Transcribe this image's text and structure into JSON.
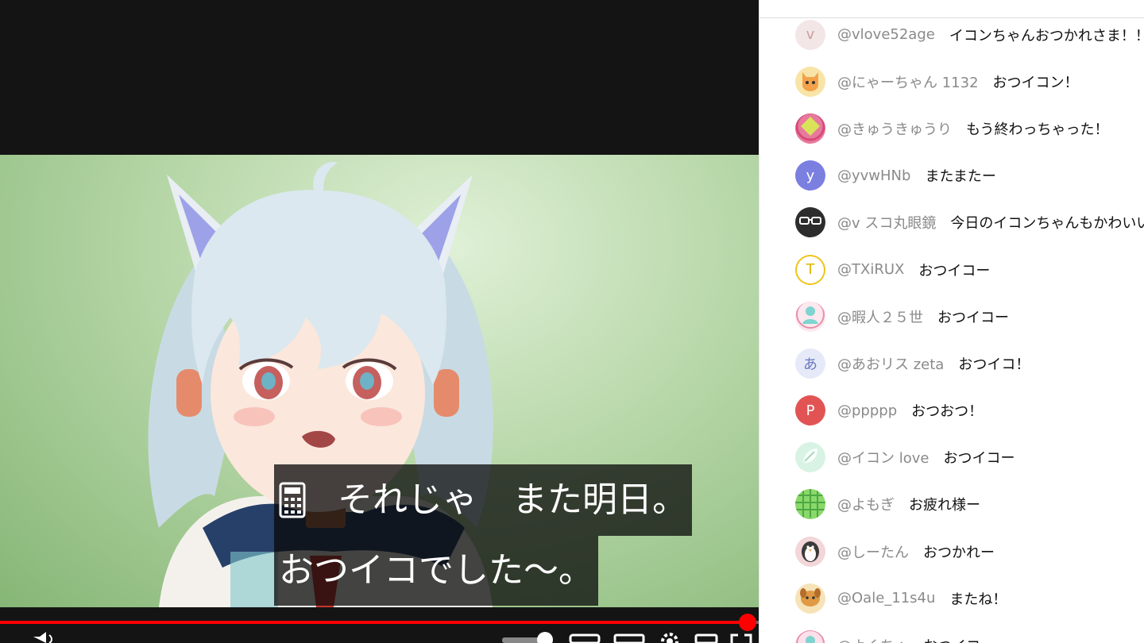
{
  "video": {
    "captions": {
      "line1": "それじゃ　また明日。",
      "line2": "おつイコでした～。"
    },
    "progress": 0.985,
    "colors": {
      "progress": "#ff0000",
      "letterbox": "#141414"
    }
  },
  "chat": {
    "messages": [
      {
        "author": "@vlove52age",
        "text": "イコンちゃんおつかれさま！！",
        "avatar_letter": "v",
        "avatar_color": "#f3e6e6",
        "avatar_text_color": "#c9a0a0"
      },
      {
        "author": "@にゃーちゃん 1132",
        "text": "おつイコン！",
        "avatar_letter": "",
        "avatar_color": "#f9e4a8",
        "avatar_icon": "cat-avatar-icon"
      },
      {
        "author": "@きゅうきゅうり",
        "text": "もう終わっちゃった！",
        "avatar_letter": "",
        "avatar_color": "#e77a9c",
        "avatar_icon": "diamond-avatar-icon"
      },
      {
        "author": "@yvwHNb",
        "text": "またまたー",
        "avatar_letter": "y",
        "avatar_color": "#7b7fe0"
      },
      {
        "author": "@v スコ丸眼鏡",
        "text": "今日のイコンちゃんもかわいい",
        "avatar_letter": "",
        "avatar_color": "#2d2d2d",
        "avatar_icon": "glasses-avatar-icon"
      },
      {
        "author": "@TXiRUX",
        "text": "おつイコー",
        "avatar_letter": "T",
        "avatar_color": "#ffffff",
        "avatar_text_color": "#e0b500",
        "avatar_border": "#f0c419"
      },
      {
        "author": "@暇人２５世",
        "text": "おつイコー",
        "avatar_letter": "",
        "avatar_color": "#fce8ef",
        "avatar_icon": "person-avatar-icon"
      },
      {
        "author": "@あおリス zeta",
        "text": "おつイコ！",
        "avatar_letter": "あ",
        "avatar_color": "#e6eaf8",
        "avatar_text_color": "#6a78c0"
      },
      {
        "author": "@ppppp",
        "text": "おつおつ！",
        "avatar_letter": "P",
        "avatar_color": "#e25454"
      },
      {
        "author": "@イコン love",
        "text": "おつイコー",
        "avatar_letter": "",
        "avatar_color": "#d8f3e4",
        "avatar_icon": "leaf-avatar-icon"
      },
      {
        "author": "@よもぎ",
        "text": "お疲れ様ー",
        "avatar_letter": "",
        "avatar_color": "#8bd86a",
        "avatar_icon": "pattern-avatar-icon"
      },
      {
        "author": "@しーたん",
        "text": "おつかれー",
        "avatar_letter": "",
        "avatar_color": "#f2d6d9",
        "avatar_icon": "penguin-avatar-icon"
      },
      {
        "author": "@Oale_11s4u",
        "text": "またね！",
        "avatar_letter": "",
        "avatar_color": "#f7e3b8",
        "avatar_icon": "dog-avatar-icon"
      },
      {
        "author": "@よくちゃ",
        "text": "おつイコー",
        "avatar_letter": "",
        "avatar_color": "#fde0ea",
        "avatar_icon": "person-avatar-icon"
      }
    ]
  }
}
